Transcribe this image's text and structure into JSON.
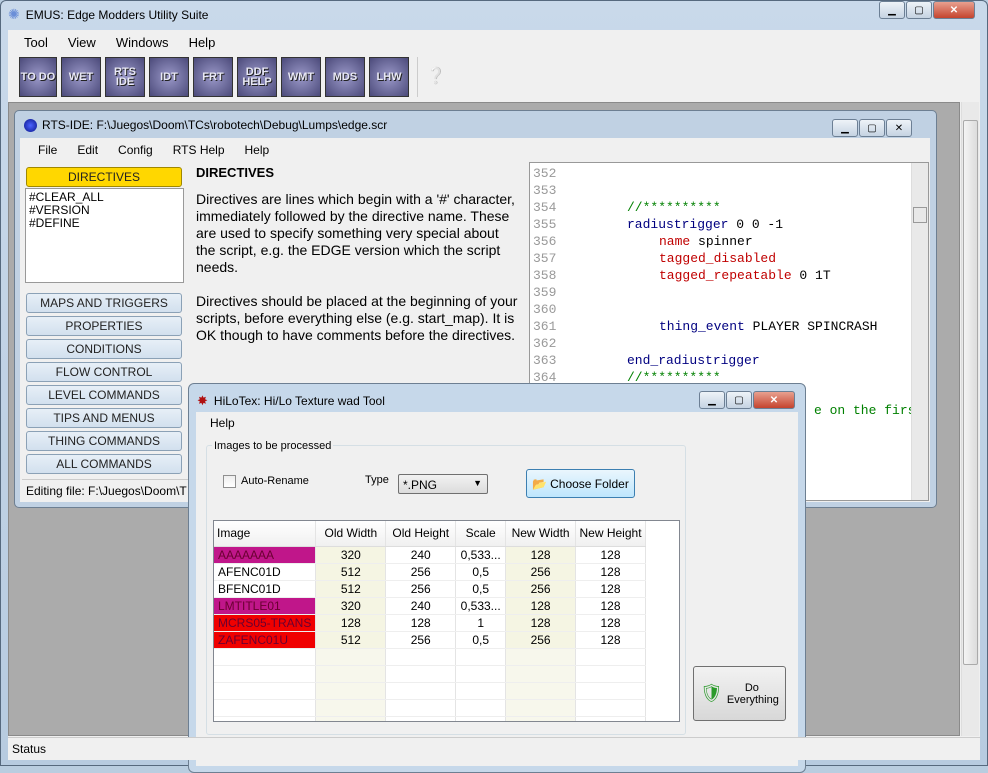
{
  "app": {
    "title": "EMUS: Edge Modders Utility Suite",
    "menu": [
      "Tool",
      "View",
      "Windows",
      "Help"
    ],
    "toolbar": [
      "TO DO",
      "WET",
      "RTS IDE",
      "IDT",
      "FRT",
      "DDF HELP",
      "WMT",
      "MDS",
      "LHW"
    ],
    "status": "Status"
  },
  "rts": {
    "title": "RTS-IDE: F:\\Juegos\\Doom\\TCs\\robotech\\Debug\\Lumps\\edge.scr",
    "menu": [
      "File",
      "Edit",
      "Config",
      "RTS Help",
      "Help"
    ],
    "active_category": "DIRECTIVES",
    "directives": [
      "#CLEAR_ALL",
      "#VERSION",
      "#DEFINE"
    ],
    "categories": [
      "MAPS AND TRIGGERS",
      "PROPERTIES",
      "CONDITIONS",
      "FLOW CONTROL",
      "LEVEL COMMANDS",
      "TIPS AND MENUS",
      "THING COMMANDS",
      "ALL COMMANDS"
    ],
    "help_title": "DIRECTIVES",
    "help_p1": "Directives are lines which begin with a '#' character, immediately followed by the directive name. These are used to specify something very special about the script, e.g. the EDGE version which the script needs.",
    "help_p2": "Directives should be placed at the beginning of your scripts, before everything else (e.g. start_map). It is OK though to have comments before the directives.",
    "status": "Editing file: F:\\Juegos\\Doom\\T",
    "code": [
      {
        "n": "352",
        "parts": []
      },
      {
        "n": "353",
        "parts": []
      },
      {
        "n": "354",
        "indent": 1,
        "parts": [
          {
            "c": "gr",
            "t": "//**********"
          }
        ]
      },
      {
        "n": "355",
        "indent": 1,
        "parts": [
          {
            "c": "kw",
            "t": "radiustrigger"
          },
          {
            "c": "",
            "t": " 0 0 -1"
          }
        ]
      },
      {
        "n": "356",
        "indent": 2,
        "parts": [
          {
            "c": "rd",
            "t": "name"
          },
          {
            "c": "",
            "t": " spinner"
          }
        ]
      },
      {
        "n": "357",
        "indent": 2,
        "parts": [
          {
            "c": "rd",
            "t": "tagged_disabled"
          }
        ]
      },
      {
        "n": "358",
        "indent": 2,
        "parts": [
          {
            "c": "rd",
            "t": "tagged_repeatable"
          },
          {
            "c": "",
            "t": " 0 1T"
          }
        ]
      },
      {
        "n": "359",
        "parts": []
      },
      {
        "n": "360",
        "parts": []
      },
      {
        "n": "361",
        "indent": 2,
        "parts": [
          {
            "c": "kw",
            "t": "thing_event"
          },
          {
            "c": "",
            "t": " PLAYER SPINCRASH"
          }
        ]
      },
      {
        "n": "362",
        "parts": []
      },
      {
        "n": "363",
        "indent": 1,
        "parts": [
          {
            "c": "kw",
            "t": "end_radiustrigger"
          }
        ]
      },
      {
        "n": "364",
        "indent": 1,
        "parts": [
          {
            "c": "gr",
            "t": "//**********"
          }
        ]
      }
    ],
    "code_fragment": "e on the first"
  },
  "hilotex": {
    "title": "HiLoTex: Hi/Lo Texture wad Tool",
    "menu": [
      "Help"
    ],
    "group": "Images to be processed",
    "auto_rename": "Auto-Rename",
    "auto_rename_checked": false,
    "type_label": "Type",
    "type_value": "*.PNG",
    "choose_folder": "Choose Folder",
    "do_everything": "Do Everything",
    "columns": [
      "Image",
      "Old Width",
      "Old Height",
      "Scale",
      "New Width",
      "New Height"
    ],
    "rows": [
      {
        "name": "AAAAAAA",
        "hl": "#c0168a",
        "ow": "320",
        "oh": "240",
        "scale": "0,533...",
        "nw": "128",
        "nh": "128"
      },
      {
        "name": "AFENC01D",
        "hl": "",
        "ow": "512",
        "oh": "256",
        "scale": "0,5",
        "nw": "256",
        "nh": "128"
      },
      {
        "name": "BFENC01D",
        "hl": "",
        "ow": "512",
        "oh": "256",
        "scale": "0,5",
        "nw": "256",
        "nh": "128"
      },
      {
        "name": "LMTITLE01",
        "hl": "#c0168a",
        "ow": "320",
        "oh": "240",
        "scale": "0,533...",
        "nw": "128",
        "nh": "128"
      },
      {
        "name": "MCRS05-TRANS",
        "hl": "#f00000",
        "ow": "128",
        "oh": "128",
        "scale": "1",
        "nw": "128",
        "nh": "128"
      },
      {
        "name": "ZAFENC01U",
        "hl": "#f00000",
        "ow": "512",
        "oh": "256",
        "scale": "0,5",
        "nw": "256",
        "nh": "128"
      }
    ]
  }
}
